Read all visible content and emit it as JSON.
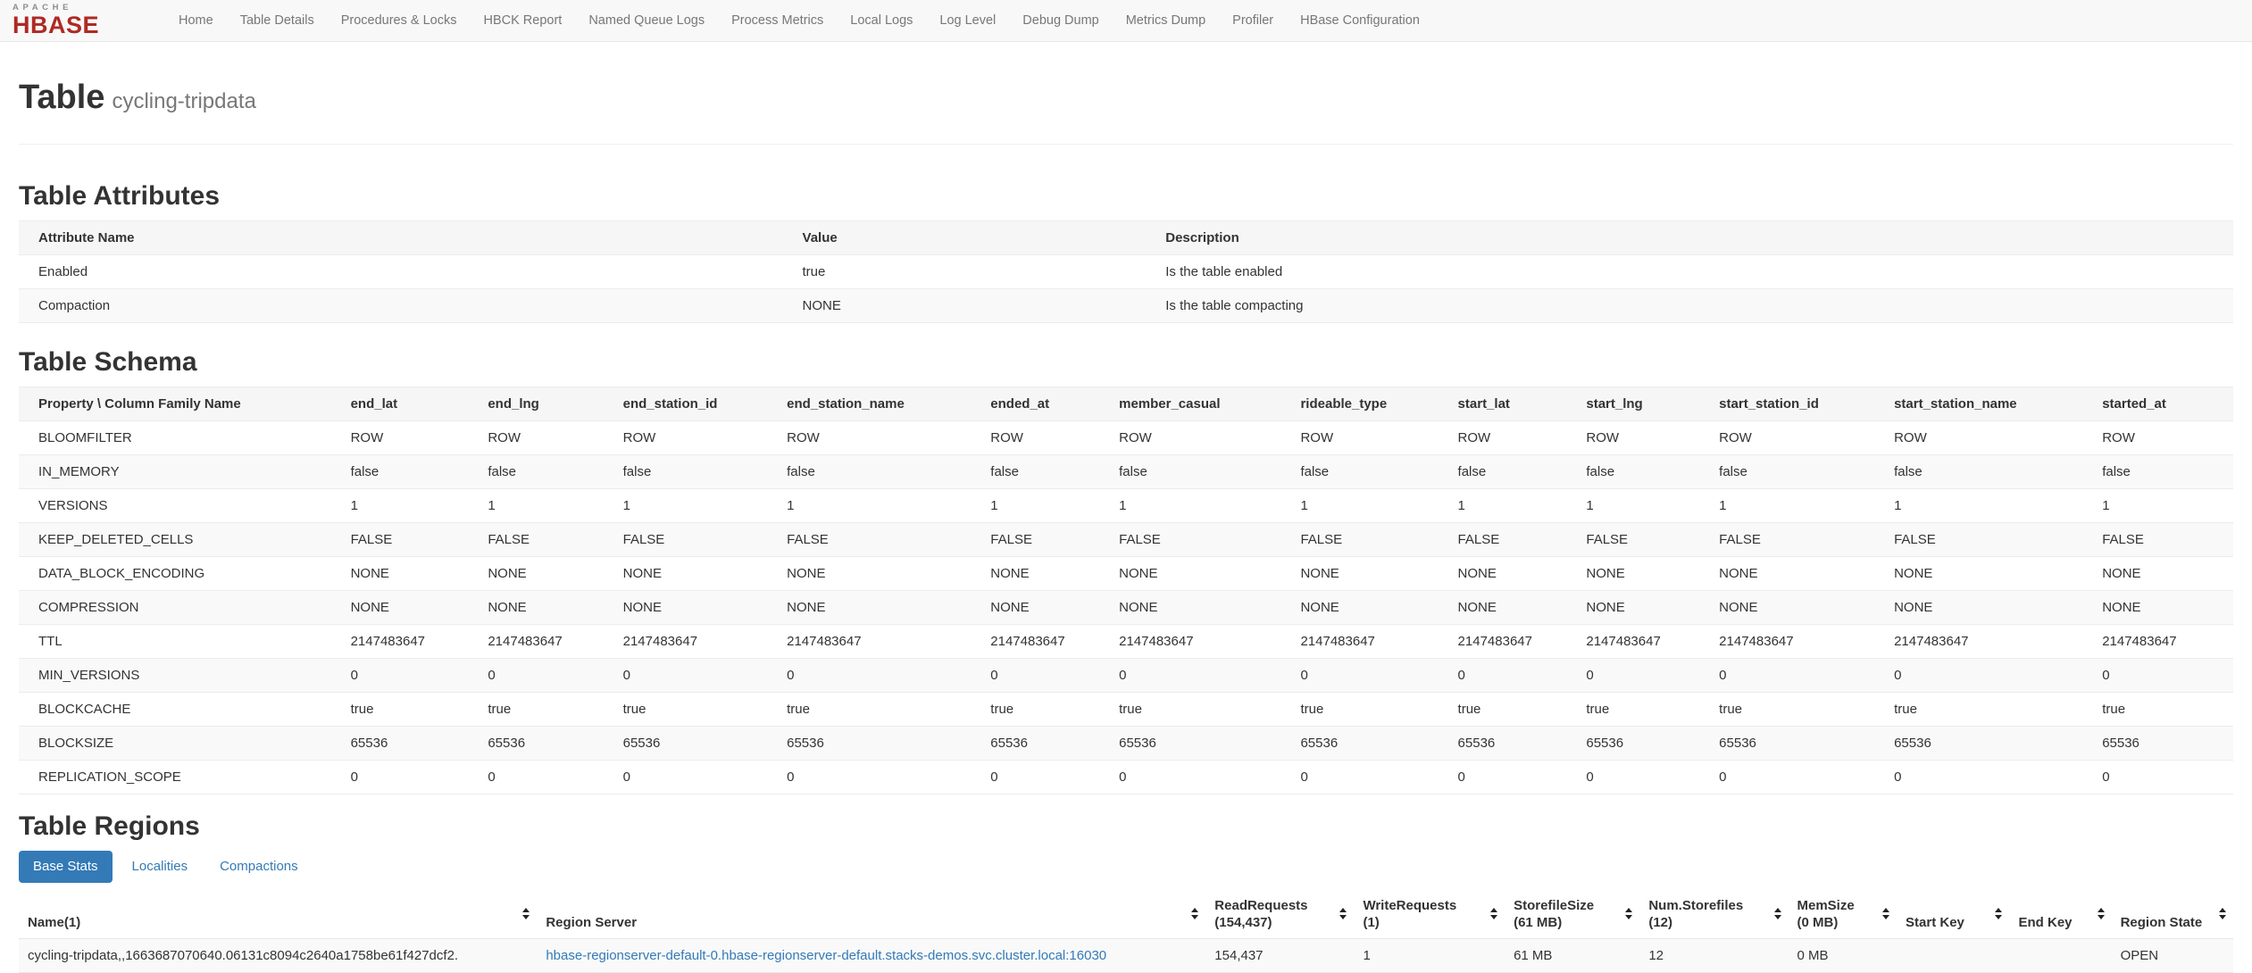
{
  "navbar": {
    "brand": {
      "top": "APACHE",
      "bottom": "HBASE"
    },
    "items": [
      "Home",
      "Table Details",
      "Procedures & Locks",
      "HBCK Report",
      "Named Queue Logs",
      "Process Metrics",
      "Local Logs",
      "Log Level",
      "Debug Dump",
      "Metrics Dump",
      "Profiler",
      "HBase Configuration"
    ]
  },
  "page": {
    "title": "Table",
    "subtitle": "cycling-tripdata"
  },
  "attributes": {
    "heading": "Table Attributes",
    "columns": [
      "Attribute Name",
      "Value",
      "Description"
    ],
    "rows": [
      [
        "Enabled",
        "true",
        "Is the table enabled"
      ],
      [
        "Compaction",
        "NONE",
        "Is the table compacting"
      ]
    ]
  },
  "schema": {
    "heading": "Table Schema",
    "corner": "Property \\ Column Family Name",
    "families": [
      "end_lat",
      "end_lng",
      "end_station_id",
      "end_station_name",
      "ended_at",
      "member_casual",
      "rideable_type",
      "start_lat",
      "start_lng",
      "start_station_id",
      "start_station_name",
      "started_at"
    ],
    "rows": [
      {
        "property": "BLOOMFILTER",
        "value": "ROW"
      },
      {
        "property": "IN_MEMORY",
        "value": "false"
      },
      {
        "property": "VERSIONS",
        "value": "1"
      },
      {
        "property": "KEEP_DELETED_CELLS",
        "value": "FALSE"
      },
      {
        "property": "DATA_BLOCK_ENCODING",
        "value": "NONE"
      },
      {
        "property": "COMPRESSION",
        "value": "NONE"
      },
      {
        "property": "TTL",
        "value": "2147483647"
      },
      {
        "property": "MIN_VERSIONS",
        "value": "0"
      },
      {
        "property": "BLOCKCACHE",
        "value": "true"
      },
      {
        "property": "BLOCKSIZE",
        "value": "65536"
      },
      {
        "property": "REPLICATION_SCOPE",
        "value": "0"
      }
    ]
  },
  "regions": {
    "heading": "Table Regions",
    "tabs": [
      {
        "label": "Base Stats",
        "active": true
      },
      {
        "label": "Localities",
        "active": false
      },
      {
        "label": "Compactions",
        "active": false
      }
    ],
    "columns": [
      {
        "label": "Name(1)",
        "sub": ""
      },
      {
        "label": "Region Server",
        "sub": ""
      },
      {
        "label": "ReadRequests",
        "sub": "(154,437)"
      },
      {
        "label": "WriteRequests",
        "sub": "(1)"
      },
      {
        "label": "StorefileSize",
        "sub": "(61 MB)"
      },
      {
        "label": "Num.Storefiles",
        "sub": "(12)"
      },
      {
        "label": "MemSize",
        "sub": "(0 MB)"
      },
      {
        "label": "Start Key",
        "sub": ""
      },
      {
        "label": "End Key",
        "sub": ""
      },
      {
        "label": "Region State",
        "sub": ""
      }
    ],
    "row": {
      "name": "cycling-tripdata,,1663687070640.06131c8094c2640a1758be61f427dcf2.",
      "region_server": "hbase-regionserver-default-0.hbase-regionserver-default.stacks-demos.svc.cluster.local:16030",
      "read_requests": "154,437",
      "write_requests": "1",
      "storefile_size": "61 MB",
      "num_storefiles": "12",
      "mem_size": "0 MB",
      "start_key": "",
      "end_key": "",
      "region_state": "OPEN"
    }
  },
  "colors": {
    "accent": "#337ab7",
    "brand_red": "#ae2a24",
    "link": "#337ab7"
  }
}
